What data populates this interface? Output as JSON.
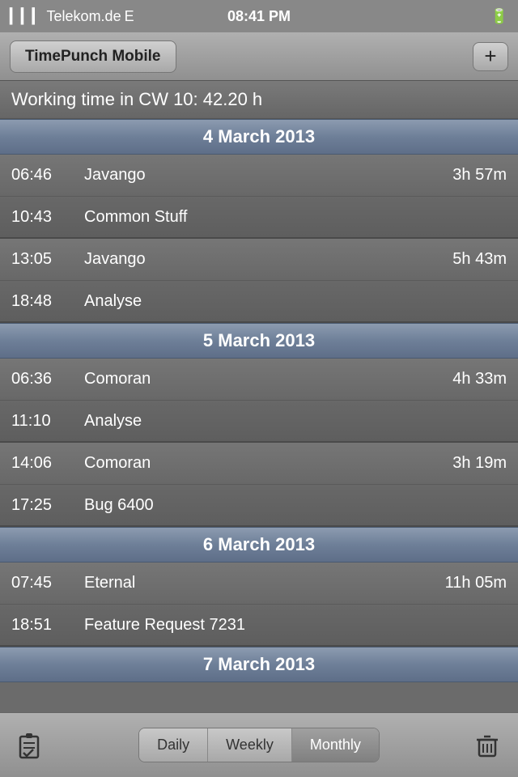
{
  "status": {
    "carrier": "Telekom.de",
    "network": "E",
    "time": "08:41 PM"
  },
  "nav": {
    "title": "TimePunch Mobile",
    "add_label": "+"
  },
  "working_time": {
    "label": "Working time in CW 10: 42.20 h"
  },
  "days": [
    {
      "date": "4 March 2013",
      "entries": [
        {
          "start": "06:46",
          "name": "Javango",
          "duration": "3h 57m"
        },
        {
          "start": "10:43",
          "name": "Common Stuff",
          "duration": ""
        },
        {
          "start": "13:05",
          "name": "Javango",
          "duration": "5h 43m"
        },
        {
          "start": "18:48",
          "name": "Analyse",
          "duration": ""
        }
      ]
    },
    {
      "date": "5 March 2013",
      "entries": [
        {
          "start": "06:36",
          "name": "Comoran",
          "duration": "4h 33m"
        },
        {
          "start": "11:10",
          "name": "Analyse",
          "duration": ""
        },
        {
          "start": "14:06",
          "name": "Comoran",
          "duration": "3h 19m"
        },
        {
          "start": "17:25",
          "name": "Bug 6400",
          "duration": ""
        }
      ]
    },
    {
      "date": "6 March 2013",
      "entries": [
        {
          "start": "07:45",
          "name": "Eternal",
          "duration": "11h 05m"
        },
        {
          "start": "18:51",
          "name": "Feature Request 7231",
          "duration": ""
        }
      ]
    },
    {
      "date": "7 March 2013",
      "entries": []
    }
  ],
  "toolbar": {
    "tabs": [
      {
        "label": "Daily",
        "active": false
      },
      {
        "label": "Weekly",
        "active": false
      },
      {
        "label": "Monthly",
        "active": true
      }
    ]
  }
}
